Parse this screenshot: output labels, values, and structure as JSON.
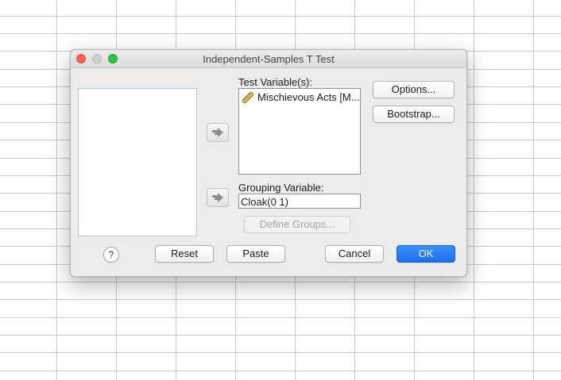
{
  "window": {
    "title": "Independent-Samples T Test"
  },
  "test_variables": {
    "label": "Test Variable(s):",
    "items": [
      {
        "label": "Mischievous Acts [M...",
        "icon": "scale-ruler-icon"
      }
    ]
  },
  "grouping_variable": {
    "label": "Grouping Variable:",
    "value": "Cloak(0 1)"
  },
  "buttons": {
    "options": "Options...",
    "bootstrap": "Bootstrap...",
    "define_groups": "Define Groups...",
    "help": "?",
    "reset": "Reset",
    "paste": "Paste",
    "cancel": "Cancel",
    "ok": "OK"
  },
  "colors": {
    "ok_accent": "#1c6ef0",
    "close": "#fc5f57",
    "maximize": "#28c840"
  }
}
